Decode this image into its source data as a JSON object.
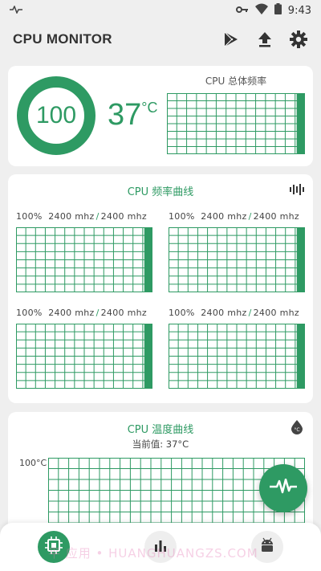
{
  "status_bar": {
    "time": "9:43"
  },
  "app_bar": {
    "title": "CPU MONITOR"
  },
  "overview": {
    "usage": "100",
    "usage_fraction": 1.0,
    "temperature_value": "37",
    "temperature_unit": "°C",
    "overall_title": "CPU 总体频率"
  },
  "frequency": {
    "title": "CPU 频率曲线",
    "cores": [
      {
        "percent": "100%",
        "current": "2400 mhz",
        "max": "2400 mhz"
      },
      {
        "percent": "100%",
        "current": "2400 mhz",
        "max": "2400 mhz"
      },
      {
        "percent": "100%",
        "current": "2400 mhz",
        "max": "2400 mhz"
      },
      {
        "percent": "100%",
        "current": "2400 mhz",
        "max": "2400 mhz"
      }
    ]
  },
  "temperature": {
    "title": "CPU 温度曲线",
    "current_label": "当前值:  37°C",
    "y_max_label": "100°C"
  },
  "watermark": "平 应用 • HUANGHUANGZS.COM",
  "colors": {
    "accent": "#2e9a63",
    "card": "#ffffff",
    "background": "#efefef"
  },
  "icons": {
    "status_key": "key-icon",
    "status_wifi": "wifi-icon",
    "status_battery": "battery-icon",
    "play": "play-store-icon",
    "upload": "upload-icon",
    "settings": "gear-icon",
    "waveform": "waveform-icon",
    "thermometer": "thermometer-drop-icon",
    "fab": "pulse-icon",
    "nav_cpu": "cpu-chip-icon",
    "nav_stats": "bar-chart-icon",
    "nav_android": "android-icon"
  }
}
